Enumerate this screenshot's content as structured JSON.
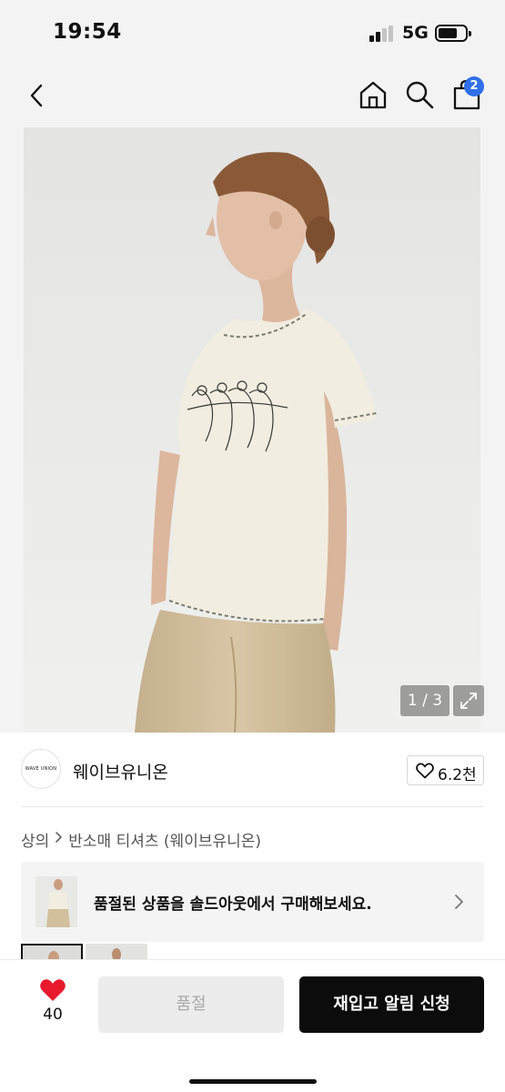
{
  "status_bar": {
    "time": "19:54",
    "network": "5G",
    "signal_bars_active": 2,
    "signal_bars_total": 4,
    "battery_level": 0.6
  },
  "nav": {
    "back_icon": "chevron-left-icon",
    "home_icon": "home-icon",
    "search_icon": "search-icon",
    "bag_icon": "shopping-bag-icon",
    "cart_count": "2",
    "badge_color": "#2f6fe8"
  },
  "gallery": {
    "counter": "1 / 3",
    "current_index": 1,
    "total": 3,
    "expand_icon": "expand-icon"
  },
  "brand": {
    "logo_text": "WAVE UNION",
    "name": "웨이브유니온",
    "like_icon": "heart-outline-icon",
    "like_count": "6.2천"
  },
  "breadcrumb": {
    "items": [
      "상의",
      "반소매 티셔츠 (웨이브유니온)"
    ],
    "separator_icon": "chevron-right-icon"
  },
  "soldout_banner": {
    "text": "품절된 상품을 솔드아웃에서 구매해보세요.",
    "arrow_icon": "chevron-right-icon"
  },
  "bottom_bar": {
    "wish_icon": "heart-filled-icon",
    "wish_color": "#e8192c",
    "wish_count": "40",
    "soldout_label": "품절",
    "restock_label": "재입고 알림 신청"
  },
  "colors": {
    "background": "#ffffff",
    "header_bg": "#f3f3f3",
    "primary_button": "#0c0c0c",
    "disabled_button": "#ececec"
  }
}
